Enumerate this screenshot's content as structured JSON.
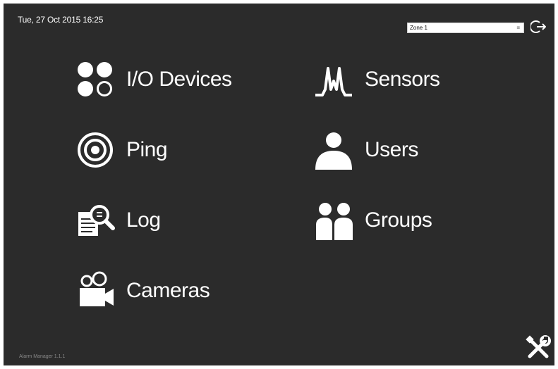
{
  "header": {
    "datetime": "Tue, 27 Oct 2015 16:25",
    "zone_selected": "Zone 1"
  },
  "menu": {
    "io_devices": "I/O Devices",
    "ping": "Ping",
    "log": "Log",
    "cameras": "Cameras",
    "sensors": "Sensors",
    "users": "Users",
    "groups": "Groups"
  },
  "footer": {
    "version": "Alarm Manager 1.1.1"
  },
  "icons": {
    "logout": "logout-icon",
    "settings": "tools-icon",
    "io_devices": "io-devices-icon",
    "ping": "target-icon",
    "log": "log-search-icon",
    "cameras": "camera-icon",
    "sensors": "waveform-icon",
    "users": "user-icon",
    "groups": "group-icon"
  },
  "colors": {
    "background": "#2b2b2b",
    "foreground": "#ffffff"
  }
}
